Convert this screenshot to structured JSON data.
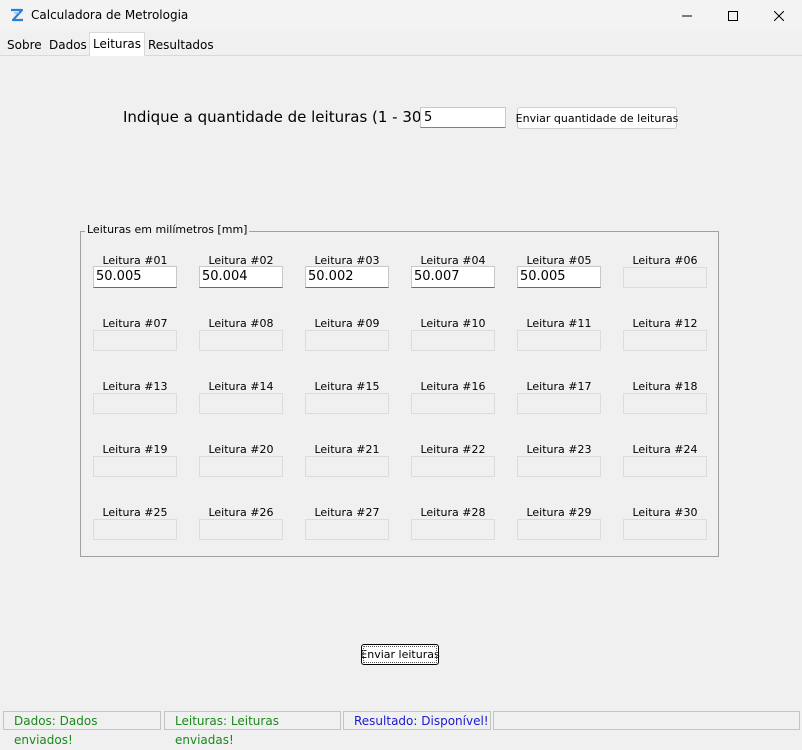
{
  "window": {
    "title": "Calculadora de Metrologia",
    "icon": "calculator-z-icon"
  },
  "tabs": [
    {
      "label": "Sobre",
      "active": false
    },
    {
      "label": "Dados",
      "active": false
    },
    {
      "label": "Leituras",
      "active": true
    },
    {
      "label": "Resultados",
      "active": false
    }
  ],
  "quantity": {
    "label": "Indique a quantidade de leituras (1 - 30):",
    "value": "5",
    "button_label": "Enviar quantidade de leituras"
  },
  "readings": {
    "group_title": "Leituras em milímetros [mm]",
    "items": [
      {
        "label": "Leitura #01",
        "value": "50.005",
        "enabled": true
      },
      {
        "label": "Leitura #02",
        "value": "50.004",
        "enabled": true
      },
      {
        "label": "Leitura #03",
        "value": "50.002",
        "enabled": true
      },
      {
        "label": "Leitura #04",
        "value": "50.007",
        "enabled": true
      },
      {
        "label": "Leitura #05",
        "value": "50.005",
        "enabled": true
      },
      {
        "label": "Leitura #06",
        "value": "",
        "enabled": false
      },
      {
        "label": "Leitura #07",
        "value": "",
        "enabled": false
      },
      {
        "label": "Leitura #08",
        "value": "",
        "enabled": false
      },
      {
        "label": "Leitura #09",
        "value": "",
        "enabled": false
      },
      {
        "label": "Leitura #10",
        "value": "",
        "enabled": false
      },
      {
        "label": "Leitura #11",
        "value": "",
        "enabled": false
      },
      {
        "label": "Leitura #12",
        "value": "",
        "enabled": false
      },
      {
        "label": "Leitura #13",
        "value": "",
        "enabled": false
      },
      {
        "label": "Leitura #14",
        "value": "",
        "enabled": false
      },
      {
        "label": "Leitura #15",
        "value": "",
        "enabled": false
      },
      {
        "label": "Leitura #16",
        "value": "",
        "enabled": false
      },
      {
        "label": "Leitura #17",
        "value": "",
        "enabled": false
      },
      {
        "label": "Leitura #18",
        "value": "",
        "enabled": false
      },
      {
        "label": "Leitura #19",
        "value": "",
        "enabled": false
      },
      {
        "label": "Leitura #20",
        "value": "",
        "enabled": false
      },
      {
        "label": "Leitura #21",
        "value": "",
        "enabled": false
      },
      {
        "label": "Leitura #22",
        "value": "",
        "enabled": false
      },
      {
        "label": "Leitura #23",
        "value": "",
        "enabled": false
      },
      {
        "label": "Leitura #24",
        "value": "",
        "enabled": false
      },
      {
        "label": "Leitura #25",
        "value": "",
        "enabled": false
      },
      {
        "label": "Leitura #26",
        "value": "",
        "enabled": false
      },
      {
        "label": "Leitura #27",
        "value": "",
        "enabled": false
      },
      {
        "label": "Leitura #28",
        "value": "",
        "enabled": false
      },
      {
        "label": "Leitura #29",
        "value": "",
        "enabled": false
      },
      {
        "label": "Leitura #30",
        "value": "",
        "enabled": false
      }
    ],
    "submit_label": "Enviar leituras"
  },
  "status": {
    "dados": "Dados: Dados enviados!",
    "leituras": "Leituras: Leituras enviadas!",
    "resultado": "Resultado: Disponível!",
    "colors": {
      "ok": "#1a8a1a",
      "info": "#1a1ad0"
    }
  }
}
